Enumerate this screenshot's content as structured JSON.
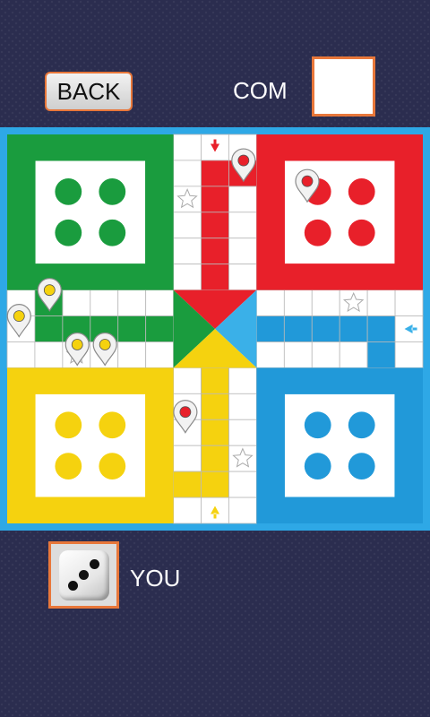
{
  "header": {
    "back_label": "BACK",
    "opponent_label": "COM"
  },
  "footer": {
    "player_label": "YOU",
    "player_dice_value": 3
  },
  "board": {
    "colors": {
      "green": "#1a9c3e",
      "red": "#e8202a",
      "yellow": "#f5d20f",
      "blue": "#2199d9",
      "frame": "#2ea8e6"
    },
    "pieces": [
      {
        "color": "red",
        "location": "red-home-slot-1"
      },
      {
        "color": "red",
        "location": "red-path-top"
      },
      {
        "color": "red",
        "location": "yellow-column"
      },
      {
        "color": "yellow",
        "location": "left-path-a"
      },
      {
        "color": "yellow",
        "location": "left-path-b"
      },
      {
        "color": "yellow",
        "location": "left-path-c"
      },
      {
        "color": "yellow",
        "location": "left-path-d"
      }
    ]
  }
}
